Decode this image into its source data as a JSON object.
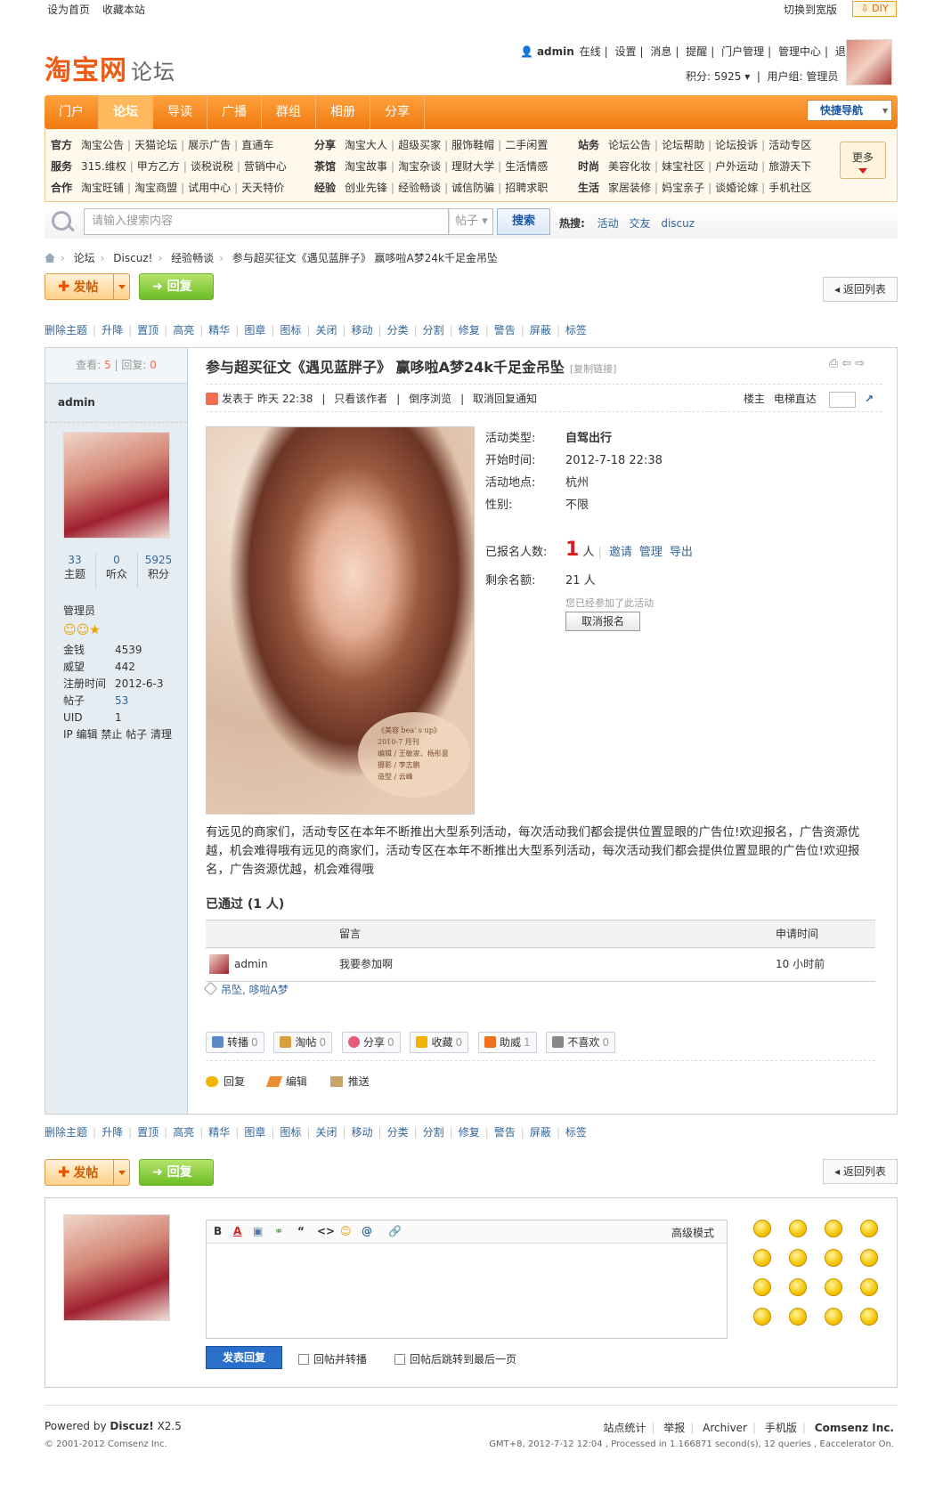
{
  "topbar": {
    "set_home": "设为首页",
    "bookmark": "收藏本站",
    "wide": "切换到宽版",
    "diy": "DIY"
  },
  "logo": {
    "brand": "淘宝网",
    "suffix": "论坛"
  },
  "user": {
    "name": "admin",
    "online": "在线",
    "links": [
      "设置",
      "消息",
      "提醒",
      "门户管理",
      "管理中心",
      "退出"
    ],
    "points": "积分: 5925",
    "group": "用户组: 管理员"
  },
  "nav": {
    "items": [
      "门户",
      "论坛",
      "导读",
      "广播",
      "群组",
      "相册",
      "分享"
    ],
    "active": 1,
    "quick": "快捷导航"
  },
  "subnav": {
    "col1": [
      {
        "h": "官方",
        "l": [
          "淘宝公告",
          "天猫论坛",
          "展示广告",
          "直通车"
        ]
      },
      {
        "h": "服务",
        "l": [
          "315.维权",
          "甲方乙方",
          "谈税说税",
          "营销中心"
        ]
      },
      {
        "h": "合作",
        "l": [
          "淘宝旺铺",
          "淘宝商盟",
          "试用中心",
          "天天特价"
        ]
      }
    ],
    "col2": [
      {
        "h": "分享",
        "l": [
          "淘宝大人",
          "超级买家",
          "服饰鞋帽",
          "二手闲置"
        ]
      },
      {
        "h": "茶馆",
        "l": [
          "淘宝故事",
          "淘宝杂谈",
          "理财大学",
          "生活情感"
        ]
      },
      {
        "h": "经验",
        "l": [
          "创业先锋",
          "经验畅谈",
          "诚信防骗",
          "招聘求职"
        ]
      }
    ],
    "col3": [
      {
        "h": "站务",
        "l": [
          "论坛公告",
          "论坛帮助",
          "论坛投诉",
          "活动专区"
        ]
      },
      {
        "h": "时尚",
        "l": [
          "美容化妆",
          "妹宝社区",
          "户外运动",
          "旅游天下"
        ]
      },
      {
        "h": "生活",
        "l": [
          "家居装修",
          "妈宝亲子",
          "谈婚论嫁",
          "手机社区"
        ]
      }
    ],
    "more": "更多"
  },
  "search": {
    "placeholder": "请输入搜索内容",
    "type": "帖子",
    "button": "搜索",
    "hot_label": "热搜:",
    "hot": [
      "活动",
      "交友",
      "discuz"
    ]
  },
  "breadcrumb": [
    "论坛",
    "Discuz!",
    "经验畅谈",
    "参与超买征文《遇见蓝胖子》 赢哆啦A梦24k千足金吊坠"
  ],
  "buttons": {
    "post": "发帖",
    "reply": "回复",
    "back": "返回列表"
  },
  "modbar": [
    "删除主题",
    "升降",
    "置顶",
    "高亮",
    "精华",
    "图章",
    "图标",
    "关闭",
    "移动",
    "分类",
    "分割",
    "修复",
    "警告",
    "屏蔽",
    "标签"
  ],
  "post": {
    "views_label": "查看:",
    "views": "5",
    "replies_label": "回复:",
    "replies": "0",
    "author": "admin",
    "stats": [
      {
        "n": "33",
        "l": "主题"
      },
      {
        "n": "0",
        "l": "听众"
      },
      {
        "n": "5925",
        "l": "积分"
      }
    ],
    "rank": "管理员",
    "info": [
      {
        "k": "金钱",
        "v": "4539"
      },
      {
        "k": "威望",
        "v": "442"
      },
      {
        "k": "注册时间",
        "v": "2012-6-3"
      },
      {
        "k": "帖子",
        "v": "53"
      },
      {
        "k": "UID",
        "v": "1"
      }
    ],
    "ip_ops": "IP 编辑 禁止 帖子 清理",
    "title": "参与超买征文《遇见蓝胖子》 赢哆啦A梦24k千足金吊坠",
    "copy_link": "[复制链接]",
    "meta": {
      "posted": "发表于",
      "time": "昨天 22:38",
      "only_author": "只看该作者",
      "reverse": "倒序浏览",
      "cancel_notify": "取消回复通知",
      "floor": "楼主",
      "goto": "电梯直达"
    },
    "photo_caption": [
      "《美容 bea' s up》",
      "2010-7 月刊",
      "编辑 / 王敏家、杨彤意",
      "摄影 / 李志鹏",
      "造型 / 云峰"
    ],
    "activity": {
      "type_k": "活动类型:",
      "type_v": "自驾出行",
      "start_k": "开始时间:",
      "start_v": "2012-7-18 22:38",
      "place_k": "活动地点:",
      "place_v": "杭州",
      "sex_k": "性别:",
      "sex_v": "不限",
      "signed_k": "已报名人数:",
      "signed_n": "1",
      "signed_u": "人",
      "invite": "邀请",
      "manage": "管理",
      "export": "导出",
      "remain_k": "剩余名额:",
      "remain_v": "21 人",
      "joined": "您已经参加了此活动",
      "cancel": "取消报名"
    },
    "body": "有远见的商家们，活动专区在本年不断推出大型系列活动，每次活动我们都会提供位置显眼的广告位!欢迎报名，广告资源优越，机会难得哦有远见的商家们，活动专区在本年不断推出大型系列活动，每次活动我们都会提供位置显眼的广告位!欢迎报名，广告资源优越，机会难得哦",
    "passed": "已通过 (1 人)",
    "table": {
      "h_msg": "留言",
      "h_time": "申请时间",
      "row_user": "admin",
      "row_msg": "我要参加啊",
      "row_time": "10 小时前"
    },
    "tags": "吊坠, 哆啦A梦",
    "actions": [
      {
        "l": "转播",
        "n": "0",
        "c": "#5a8ac6"
      },
      {
        "l": "淘帖",
        "n": "0",
        "c": "#d8a040"
      },
      {
        "l": "分享",
        "n": "0",
        "c": "#e85a7a"
      },
      {
        "l": "收藏",
        "n": "0",
        "c": "#f2b400"
      },
      {
        "l": "助威",
        "n": "1",
        "c": "#f07020"
      },
      {
        "l": "不喜欢",
        "n": "0",
        "c": "#888888"
      }
    ],
    "ops": [
      "回复",
      "编辑",
      "推送"
    ]
  },
  "editor": {
    "tools": [
      "B",
      "A",
      "▣",
      "⚭",
      "“",
      "<>",
      "☺",
      "@",
      "🔗"
    ],
    "advanced": "高级模式",
    "submit": "发表回复",
    "opt1": "回帖并转播",
    "opt2": "回帖后跳转到最后一页"
  },
  "footer": {
    "powered": "Powered by",
    "discuz": "Discuz!",
    "ver": "X2.5",
    "copy": "© 2001-2012 Comsenz Inc.",
    "links": [
      "站点统计",
      "举报",
      "Archiver",
      "手机版"
    ],
    "company": "Comsenz Inc.",
    "stats": "GMT+8, 2012-7-12 12:04 , Processed in 1.166871 second(s), 12 queries , Eaccelerator On."
  }
}
